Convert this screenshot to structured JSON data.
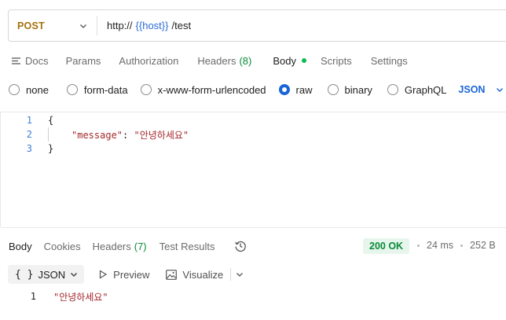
{
  "request": {
    "method": "POST",
    "url_prefix": "http://",
    "url_variable": "{{host}}",
    "url_suffix": "/test"
  },
  "request_tabs": [
    {
      "label": "Docs"
    },
    {
      "label": "Params"
    },
    {
      "label": "Authorization"
    },
    {
      "label": "Headers",
      "count": "(8)"
    },
    {
      "label": "Body",
      "active": true
    },
    {
      "label": "Scripts"
    },
    {
      "label": "Settings"
    }
  ],
  "body_types": {
    "options": [
      "none",
      "form-data",
      "x-www-form-urlencoded",
      "raw",
      "binary",
      "GraphQL"
    ],
    "selected": "raw",
    "format": "JSON"
  },
  "editor": {
    "lines": [
      {
        "number": "1",
        "text": "{"
      },
      {
        "number": "2",
        "key": "\"message\"",
        "colon": ": ",
        "value": "\"안녕하세요\""
      },
      {
        "number": "3",
        "text": "}"
      }
    ]
  },
  "response": {
    "tabs": [
      {
        "label": "Body",
        "active": true
      },
      {
        "label": "Cookies"
      },
      {
        "label": "Headers",
        "count": "(7)"
      },
      {
        "label": "Test Results"
      }
    ],
    "status": "200 OK",
    "time": "24 ms",
    "size": "252 B",
    "format_label": "JSON",
    "format_braces": "{ }",
    "preview_label": "Preview",
    "visualize_label": "Visualize",
    "lines": [
      {
        "number": "1",
        "value": "\"안녕하세요\""
      }
    ]
  },
  "colors": {
    "method": "#a3720e",
    "variable": "#2b6ad7",
    "accent": "#1a65d6",
    "success": "#0a8a3a",
    "string": "#a4282d"
  }
}
